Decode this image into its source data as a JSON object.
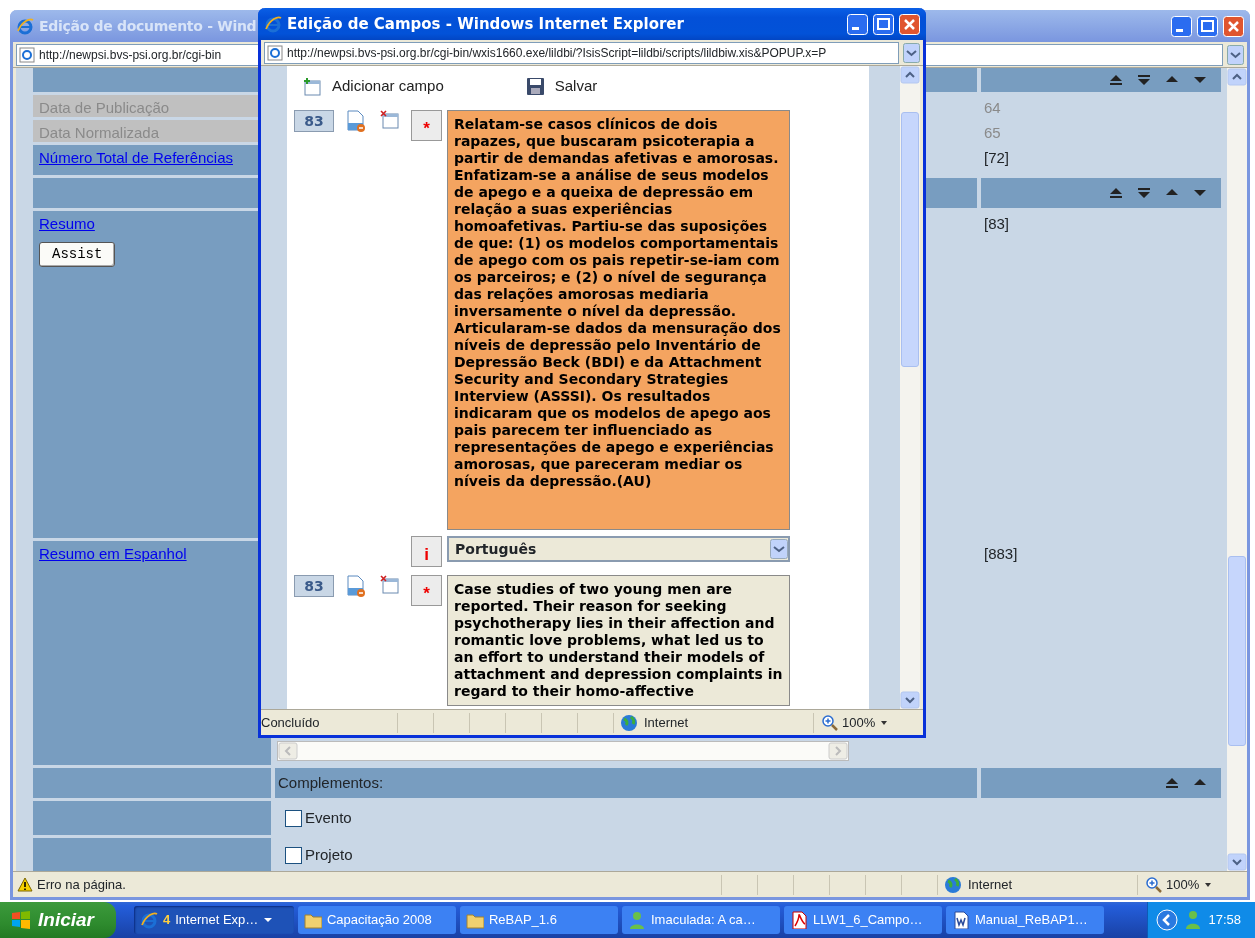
{
  "main_window": {
    "title": "Edição de documento - Wind",
    "address": "http://newpsi.bvs-psi.org.br/cgi-bin",
    "rows": [
      {
        "kind": "header",
        "move_top": true,
        "move_bottom": true,
        "move_up": true,
        "move_down": true
      },
      {
        "kind": "field",
        "label": "Data de Publicação",
        "disabled": true,
        "value": "64"
      },
      {
        "kind": "field",
        "label": "Data Normalizada",
        "disabled": true,
        "value": "65"
      },
      {
        "kind": "field",
        "label": "Número Total de Referências",
        "disabled": false,
        "value": "[72]"
      },
      {
        "kind": "header",
        "move_top": true,
        "move_bottom": true,
        "move_up": true,
        "move_down": true
      },
      {
        "kind": "field",
        "label": "Resumo",
        "disabled": false,
        "button": "Assist",
        "value": "[83]"
      },
      {
        "kind": "field",
        "label": "Resumo em Espanhol",
        "disabled": false,
        "value": "[883]"
      },
      {
        "kind": "section",
        "label": "Complementos:",
        "move_top": true,
        "move_bottom": false,
        "move_up": true,
        "move_down": false
      },
      {
        "kind": "checkbox",
        "label": "Evento",
        "checked": false
      },
      {
        "kind": "checkbox",
        "label": "Projeto",
        "checked": false
      }
    ],
    "status": "Erro na página.",
    "zone": "Internet",
    "zoom": "100%"
  },
  "popup": {
    "title": "Edição de Campos - Windows Internet Explorer",
    "address": "http://newpsi.bvs-psi.org.br/cgi-bin/wxis1660.exe/lildbi/?IsisScript=lildbi/scripts/lildbiw.xis&POPUP.x=P",
    "toolbar": [
      {
        "kind": "add",
        "label": "Adicionar campo"
      },
      {
        "kind": "save",
        "label": "Salvar"
      }
    ],
    "fields": [
      {
        "kind": "text",
        "tag": "83",
        "marker": "*",
        "highlighted": true,
        "text": "Relatam-se casos clínicos de dois rapazes, que buscaram psicoterapia a partir de demandas afetivas e amorosas. Enfatizam-se a análise de seus modelos de apego e a queixa de depressão em relação a suas experiências homoafetivas. Partiu-se das suposições de que: (1) os modelos comportamentais de apego com os pais repetir-se-iam com os parceiros; e (2) o nível de segurança das relações amorosas mediaria inversamente o nível da depressão. Articularam-se dados da mensuração dos níveis de depressão pelo Inventário de Depressão Beck (BDI) e da Attachment Security and Secondary Strategies Interview (ASSSI). Os resultados indicaram que os modelos de apego aos pais parecem ter influenciado as representações de apego e experiências amorosas, que pareceram mediar os níveis da depressão.(AU)"
      },
      {
        "kind": "select",
        "marker": "i",
        "value": "Português"
      },
      {
        "kind": "text",
        "tag": "83",
        "marker": "*",
        "highlighted": false,
        "text": "Case studies of two young men are reported. Their reason for seeking psychotherapy lies in their affection and romantic love problems, what led us to an effort to understand their models of attachment and depression complaints in regard to their homo-affective"
      }
    ],
    "status": "Concluído",
    "zone": "Internet",
    "zoom": "100%"
  },
  "taskbar": {
    "start": "Iniciar",
    "items": [
      {
        "kind": "browser",
        "count": "4",
        "label": "Internet Exp…",
        "selected": true
      },
      {
        "kind": "folder",
        "label": "Capacitação 2008",
        "selected": false
      },
      {
        "kind": "folder",
        "label": "ReBAP_1.6",
        "selected": false
      },
      {
        "kind": "chat",
        "label": "Imaculada: A ca…",
        "selected": false
      },
      {
        "kind": "pdf",
        "label": "LLW1_6_Campo…",
        "selected": false
      },
      {
        "kind": "word",
        "label": "Manual_ReBAP1…",
        "selected": false
      }
    ],
    "clock": "17:58"
  }
}
